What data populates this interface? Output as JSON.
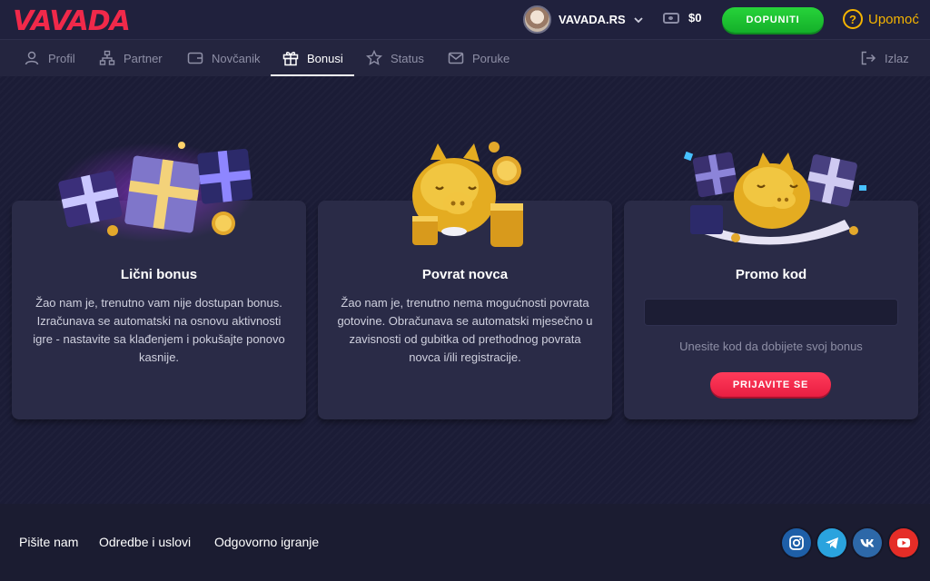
{
  "app": {
    "logo": "VAVADA",
    "account_name": "VAVADA.RS",
    "balance": "$0",
    "deposit_label": "DOPUNITI",
    "help_label": "Upomoć"
  },
  "nav": {
    "items": [
      {
        "label": "Profil",
        "icon": "user-icon"
      },
      {
        "label": "Partner",
        "icon": "network-icon"
      },
      {
        "label": "Novčanik",
        "icon": "wallet-icon"
      },
      {
        "label": "Bonusi",
        "icon": "gift-icon",
        "active": true
      },
      {
        "label": "Status",
        "icon": "star-icon"
      },
      {
        "label": "Poruke",
        "icon": "mail-icon"
      }
    ],
    "logout_label": "Izlaz"
  },
  "cards": {
    "personal": {
      "title": "Lični bonus",
      "text": "Žao nam je, trenutno vam nije dostupan bonus. Izračunava se automatski na osnovu aktivnosti igre - nastavite sa klađenjem i pokušajte ponovo kasnije."
    },
    "cashback": {
      "title": "Povrat novca",
      "text": "Žao nam je, trenutno nema mogućnosti povrata gotovine. Obračunava se automatski mjesečno u zavisnosti od gubitka od prethodnog povrata novca i/ili registracije."
    },
    "promo": {
      "title": "Promo kod",
      "input_value": "",
      "hint": "Unesite kod da dobijete svoj bonus",
      "button_label": "PRIJAVITE SE"
    }
  },
  "footer": {
    "links": [
      "Pišite nam",
      "Odredbe i uslovi",
      "Odgovorno igranje"
    ],
    "socials": [
      {
        "name": "instagram-icon",
        "color": "#1e5fa8"
      },
      {
        "name": "telegram-icon",
        "color": "#2aa3de"
      },
      {
        "name": "vk-icon",
        "color": "#2d68a8"
      },
      {
        "name": "youtube-icon",
        "color": "#e52d27"
      }
    ]
  },
  "colors": {
    "brand": "#f0294a",
    "deposit": "#1fc233",
    "help": "#f5b400",
    "background": "#1b1c36",
    "card": "#2a2b47"
  }
}
